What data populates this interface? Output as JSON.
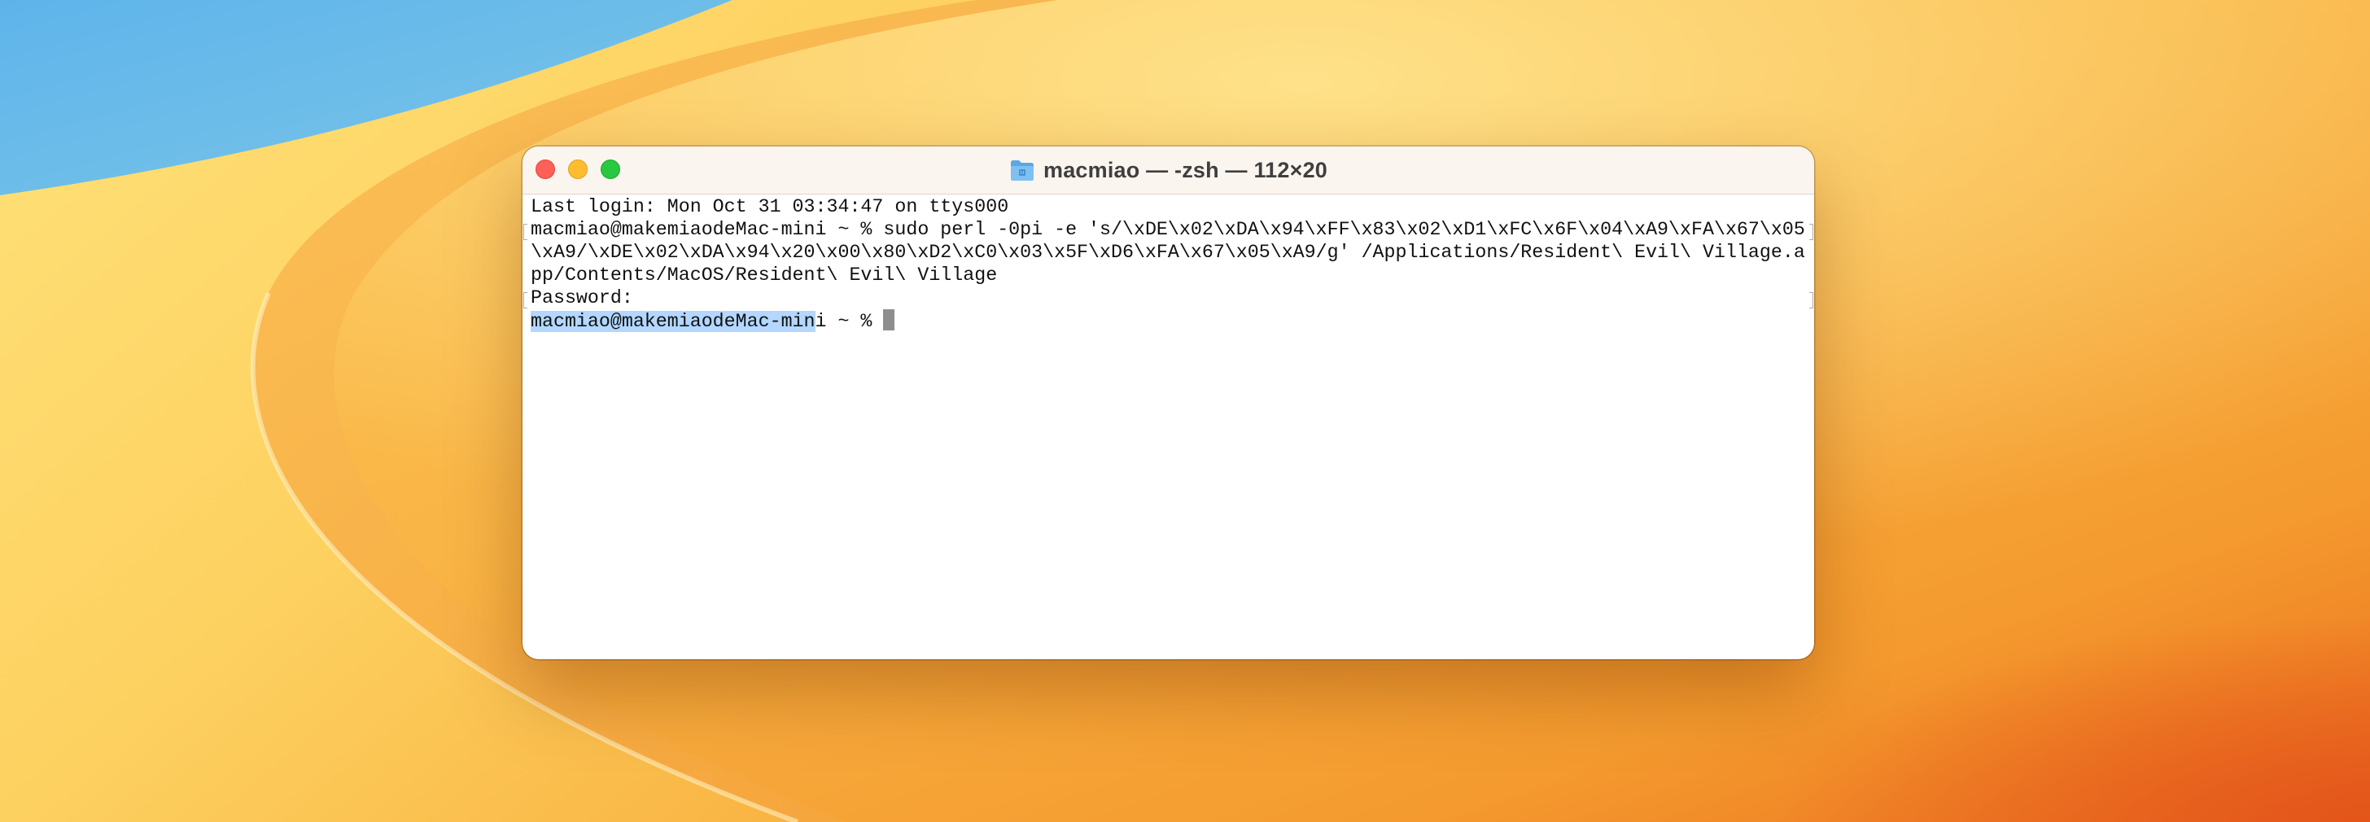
{
  "window": {
    "title": "macmiao — -zsh — 112×20",
    "title_icon": "folder-icon",
    "controls": [
      "close",
      "minimize",
      "zoom"
    ]
  },
  "terminal": {
    "last_login": "Last login: Mon Oct 31 03:34:47 on ttys000",
    "command_line_1": "macmiao@makemiaodeMac-mini ~ % sudo perl -0pi -e 's/\\xDE\\x02\\xDA\\x94\\xFF\\x83\\x02\\xD1\\xFC\\x6F\\x04\\xA9\\xFA\\x67\\x05",
    "command_line_2": "\\xA9/\\xDE\\x02\\xDA\\x94\\x20\\x00\\x80\\xD2\\xC0\\x03\\x5F\\xD6\\xFA\\x67\\x05\\xA9/g' /Applications/Resident\\ Evil\\ Village.a",
    "command_line_3": "pp/Contents/MacOS/Resident\\ Evil\\ Village",
    "password_prompt": "Password:",
    "prompt_selected": "macmiao@makemiaodeMac-min",
    "prompt_rest": "i ~ % "
  },
  "colors": {
    "accent_selection": "#b3d7ff",
    "close": "#fe5f57",
    "minimize": "#febc2e",
    "zoom": "#28c840"
  }
}
